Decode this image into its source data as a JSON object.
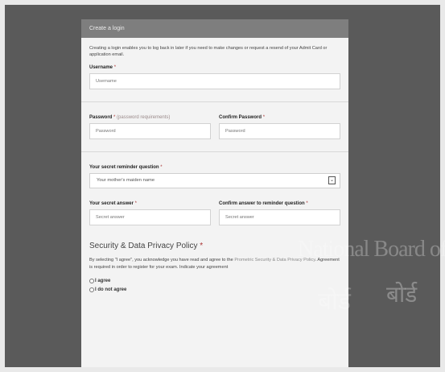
{
  "form": {
    "header_title": "Create a login",
    "intro": "Creating a login enables you to log back in later if you need to make changes or request a resend of your Admit Card or application email.",
    "required_mark": "*",
    "username": {
      "label": "Username",
      "placeholder": "Username"
    },
    "password": {
      "label": "Password",
      "requirements_link": "(password requirements)",
      "placeholder": "Password"
    },
    "confirm_password": {
      "label": "Confirm Password",
      "placeholder": "Password"
    },
    "secret_question": {
      "label": "Your secret reminder question",
      "selected": "Your mother's maiden name"
    },
    "secret_answer": {
      "label": "Your secret answer",
      "placeholder": "Secret answer"
    },
    "confirm_answer": {
      "label": "Confirm answer to reminder question",
      "placeholder": "Secret answer"
    },
    "privacy": {
      "title": "Security & Data Privacy Policy",
      "text_before": "By selecting \"I agree\", you acknowledge you have read and agree to the",
      "link": "Prometric Security & Data Privacy Policy",
      "text_after": ". Agreement is required in order to register for your exam. Indicate your agreement",
      "options": [
        "I agree",
        "I do not agree"
      ]
    }
  },
  "watermark": {
    "line1": "National Board of Examinations",
    "line2": "बोर्ड",
    "line3": "बोर्ड"
  },
  "colors": {
    "backdrop": "#5a5a5a",
    "panel": "#f3f3f3",
    "header": "#7e7e7e"
  }
}
